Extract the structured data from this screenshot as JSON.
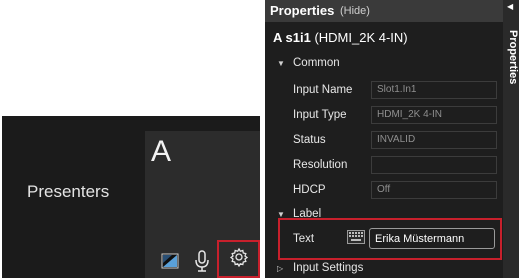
{
  "presenter": {
    "label": "Presenters",
    "tile_letter": "A"
  },
  "properties": {
    "title": "Properties",
    "hide": "(Hide)",
    "side_tab": "Properties",
    "device_id": "A s1i1",
    "device_detail": "(HDMI_2K 4-IN)",
    "sections": {
      "common": "Common",
      "label": "Label",
      "input_settings": "Input Settings"
    },
    "common_fields": [
      {
        "label": "Input Name",
        "value": "Slot1.In1"
      },
      {
        "label": "Input Type",
        "value": "HDMI_2K 4-IN"
      },
      {
        "label": "Status",
        "value": "INVALID"
      },
      {
        "label": "Resolution",
        "value": ""
      },
      {
        "label": "HDCP",
        "value": "Off"
      }
    ],
    "label_field": {
      "label": "Text",
      "value": "Erika Müstermann"
    }
  },
  "icons": {
    "tile": "tile-image-icon",
    "mic": "microphone-icon",
    "gear": "gear-icon",
    "keyboard": "keyboard-icon"
  },
  "colors": {
    "highlight": "#c8202c",
    "panel_bg": "#1e1e1e",
    "presenter_bg": "#1b1b1b"
  }
}
